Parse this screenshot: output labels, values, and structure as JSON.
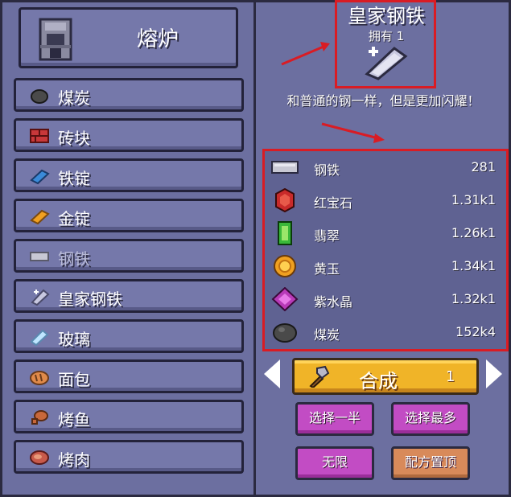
{
  "furnace": {
    "title": "熔炉"
  },
  "recipes": [
    {
      "label": "煤炭",
      "icon": "coal-icon"
    },
    {
      "label": "砖块",
      "icon": "brick-icon"
    },
    {
      "label": "铁锭",
      "icon": "iron-ingot-icon"
    },
    {
      "label": "金锭",
      "icon": "gold-ingot-icon"
    },
    {
      "label": "钢铁",
      "icon": "steel-icon"
    },
    {
      "label": "皇家钢铁",
      "icon": "royal-steel-icon"
    },
    {
      "label": "玻璃",
      "icon": "glass-icon"
    },
    {
      "label": "面包",
      "icon": "bread-icon"
    },
    {
      "label": "烤鱼",
      "icon": "cooked-fish-icon"
    },
    {
      "label": "烤肉",
      "icon": "cooked-meat-icon"
    }
  ],
  "selected": {
    "title": "皇家钢铁",
    "owned": "拥有 1",
    "description": "和普通的钢一样，但是更加闪耀！"
  },
  "ingredients": [
    {
      "name": "钢铁",
      "amount": "281",
      "icon": "steel-icon"
    },
    {
      "name": "红宝石",
      "amount": "1.31k1",
      "icon": "ruby-icon"
    },
    {
      "name": "翡翠",
      "amount": "1.26k1",
      "icon": "emerald-icon"
    },
    {
      "name": "黄玉",
      "amount": "1.34k1",
      "icon": "topaz-icon"
    },
    {
      "name": "紫水晶",
      "amount": "1.32k1",
      "icon": "amethyst-icon"
    },
    {
      "name": "煤炭",
      "amount": "152k4",
      "icon": "coal-icon"
    }
  ],
  "craft": {
    "label": "合成",
    "count": "1",
    "icon": "hammer-icon"
  },
  "buttons": {
    "select_half": "选择一半",
    "select_max": "选择最多",
    "infinite": "无限",
    "pin_recipe": "配方置顶"
  },
  "colors": {
    "accent_red": "#d91c24",
    "craft_yellow": "#f0b428",
    "button_pink": "#c24cc4",
    "button_orange": "#d88a5a"
  }
}
